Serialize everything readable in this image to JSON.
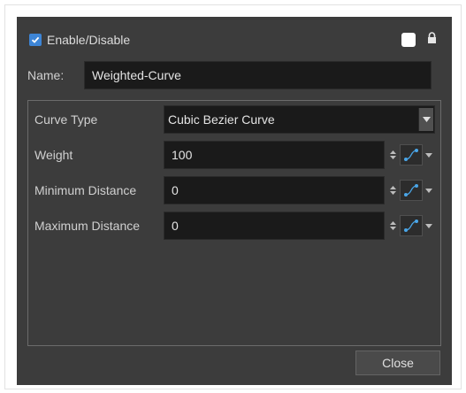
{
  "header": {
    "enable_label": "Enable/Disable",
    "enabled": true
  },
  "name": {
    "label": "Name:",
    "value": "Weighted-Curve"
  },
  "fields": {
    "curve_type": {
      "label": "Curve Type",
      "value": "Cubic Bezier Curve"
    },
    "weight": {
      "label": "Weight",
      "value": "100"
    },
    "min_distance": {
      "label": "Minimum Distance",
      "value": "0"
    },
    "max_distance": {
      "label": "Maximum Distance",
      "value": "0"
    }
  },
  "footer": {
    "close_label": "Close"
  },
  "colors": {
    "dialog_bg": "#3c3c3c",
    "input_bg": "#1a1a1a",
    "accent": "#3d85d6"
  },
  "icons": [
    "checkbox-checked-icon",
    "color-swatch-icon",
    "lock-icon",
    "chevron-down-icon",
    "spinner-icon",
    "function-curve-icon"
  ]
}
